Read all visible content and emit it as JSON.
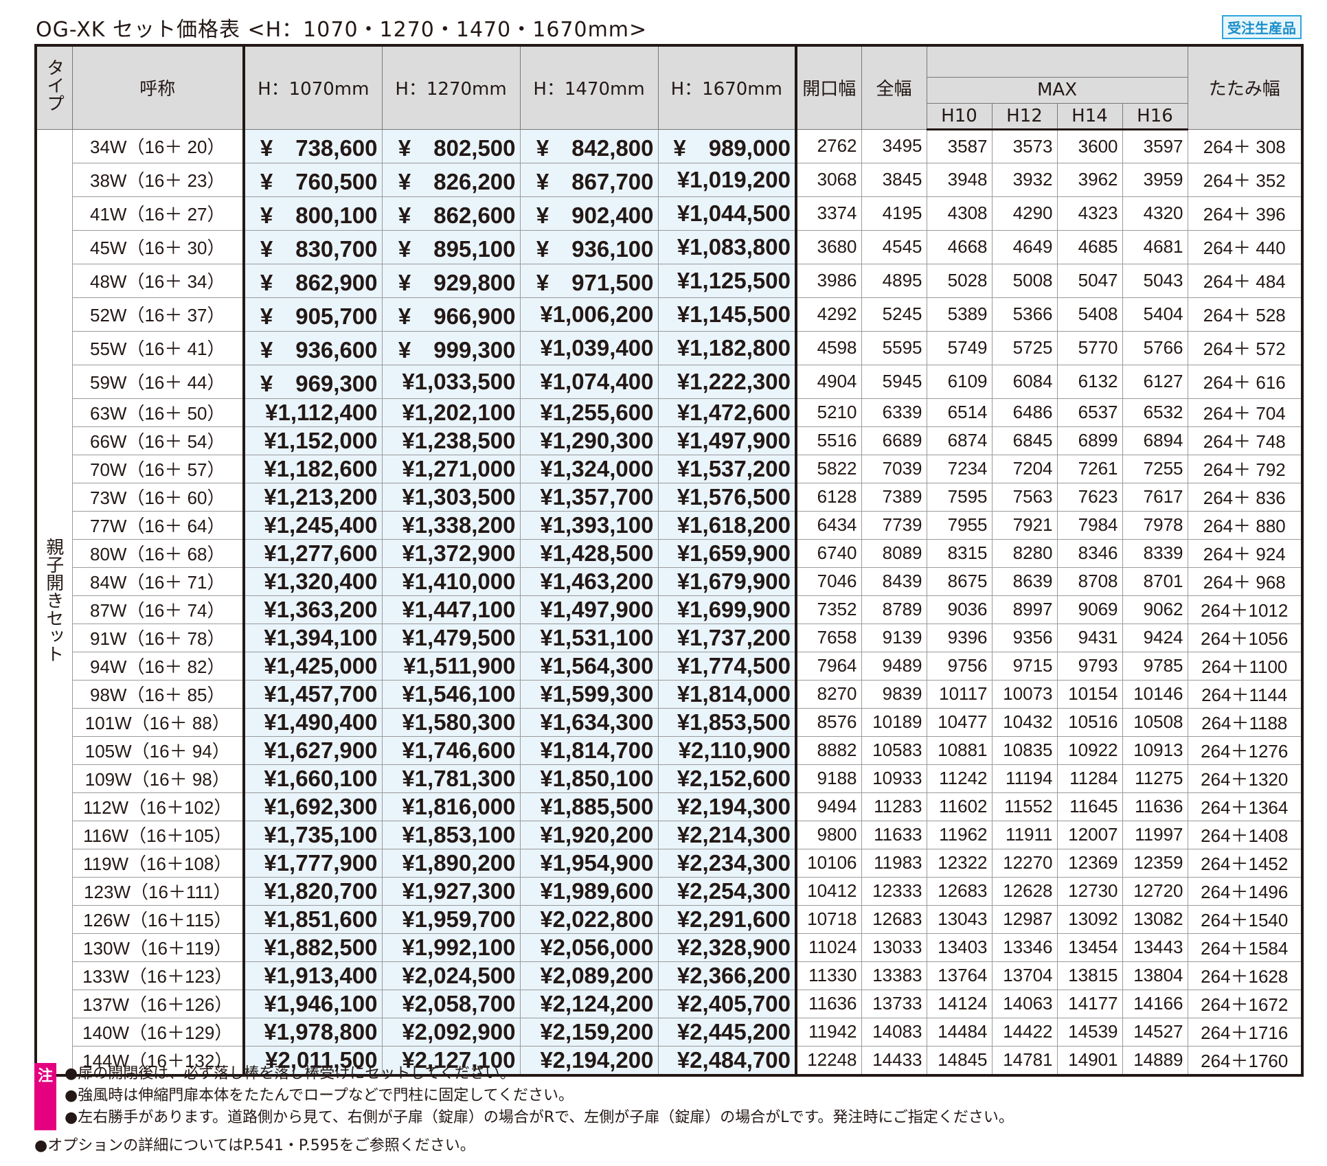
{
  "title": "OG-XK セット価格表 <H：1070・1270・1470・1670mm>",
  "badge": "受注生産品",
  "headers": {
    "type": "タイプ",
    "name": "呼称",
    "h1070": "H：1070mm",
    "h1270": "H：1270mm",
    "h1470": "H：1470mm",
    "h1670": "H：1670mm",
    "opening": "開口幅",
    "total": "全幅",
    "max": "MAX",
    "h10": "H10",
    "h12": "H12",
    "h14": "H14",
    "h16": "H16",
    "fold": "たたみ幅"
  },
  "type_label": "親子開きセット",
  "rows": [
    {
      "name": "34W（16＋ 20）",
      "p1": "¥　738,600",
      "p2": "¥　802,500",
      "p3": "¥　842,800",
      "p4": "¥　989,000",
      "open": "2762",
      "total": "3495",
      "h10": "3587",
      "h12": "3573",
      "h14": "3600",
      "h16": "3597",
      "fold": "264＋ 308"
    },
    {
      "name": "38W（16＋ 23）",
      "p1": "¥　760,500",
      "p2": "¥　826,200",
      "p3": "¥　867,700",
      "p4": "¥1,019,200",
      "open": "3068",
      "total": "3845",
      "h10": "3948",
      "h12": "3932",
      "h14": "3962",
      "h16": "3959",
      "fold": "264＋ 352"
    },
    {
      "name": "41W（16＋ 27）",
      "p1": "¥　800,100",
      "p2": "¥　862,600",
      "p3": "¥　902,400",
      "p4": "¥1,044,500",
      "open": "3374",
      "total": "4195",
      "h10": "4308",
      "h12": "4290",
      "h14": "4323",
      "h16": "4320",
      "fold": "264＋ 396"
    },
    {
      "name": "45W（16＋ 30）",
      "p1": "¥　830,700",
      "p2": "¥　895,100",
      "p3": "¥　936,100",
      "p4": "¥1,083,800",
      "open": "3680",
      "total": "4545",
      "h10": "4668",
      "h12": "4649",
      "h14": "4685",
      "h16": "4681",
      "fold": "264＋ 440"
    },
    {
      "name": "48W（16＋ 34）",
      "p1": "¥　862,900",
      "p2": "¥　929,800",
      "p3": "¥　971,500",
      "p4": "¥1,125,500",
      "open": "3986",
      "total": "4895",
      "h10": "5028",
      "h12": "5008",
      "h14": "5047",
      "h16": "5043",
      "fold": "264＋ 484"
    },
    {
      "name": "52W（16＋ 37）",
      "p1": "¥　905,700",
      "p2": "¥　966,900",
      "p3": "¥1,006,200",
      "p4": "¥1,145,500",
      "open": "4292",
      "total": "5245",
      "h10": "5389",
      "h12": "5366",
      "h14": "5408",
      "h16": "5404",
      "fold": "264＋ 528"
    },
    {
      "name": "55W（16＋ 41）",
      "p1": "¥　936,600",
      "p2": "¥　999,300",
      "p3": "¥1,039,400",
      "p4": "¥1,182,800",
      "open": "4598",
      "total": "5595",
      "h10": "5749",
      "h12": "5725",
      "h14": "5770",
      "h16": "5766",
      "fold": "264＋ 572"
    },
    {
      "name": "59W（16＋ 44）",
      "p1": "¥　969,300",
      "p2": "¥1,033,500",
      "p3": "¥1,074,400",
      "p4": "¥1,222,300",
      "open": "4904",
      "total": "5945",
      "h10": "6109",
      "h12": "6084",
      "h14": "6132",
      "h16": "6127",
      "fold": "264＋ 616"
    },
    {
      "name": "63W（16＋ 50）",
      "p1": "¥1,112,400",
      "p2": "¥1,202,100",
      "p3": "¥1,255,600",
      "p4": "¥1,472,600",
      "open": "5210",
      "total": "6339",
      "h10": "6514",
      "h12": "6486",
      "h14": "6537",
      "h16": "6532",
      "fold": "264＋ 704"
    },
    {
      "name": "66W（16＋ 54）",
      "p1": "¥1,152,000",
      "p2": "¥1,238,500",
      "p3": "¥1,290,300",
      "p4": "¥1,497,900",
      "open": "5516",
      "total": "6689",
      "h10": "6874",
      "h12": "6845",
      "h14": "6899",
      "h16": "6894",
      "fold": "264＋ 748"
    },
    {
      "name": "70W（16＋ 57）",
      "p1": "¥1,182,600",
      "p2": "¥1,271,000",
      "p3": "¥1,324,000",
      "p4": "¥1,537,200",
      "open": "5822",
      "total": "7039",
      "h10": "7234",
      "h12": "7204",
      "h14": "7261",
      "h16": "7255",
      "fold": "264＋ 792"
    },
    {
      "name": "73W（16＋ 60）",
      "p1": "¥1,213,200",
      "p2": "¥1,303,500",
      "p3": "¥1,357,700",
      "p4": "¥1,576,500",
      "open": "6128",
      "total": "7389",
      "h10": "7595",
      "h12": "7563",
      "h14": "7623",
      "h16": "7617",
      "fold": "264＋ 836"
    },
    {
      "name": "77W（16＋ 64）",
      "p1": "¥1,245,400",
      "p2": "¥1,338,200",
      "p3": "¥1,393,100",
      "p4": "¥1,618,200",
      "open": "6434",
      "total": "7739",
      "h10": "7955",
      "h12": "7921",
      "h14": "7984",
      "h16": "7978",
      "fold": "264＋ 880"
    },
    {
      "name": "80W（16＋ 68）",
      "p1": "¥1,277,600",
      "p2": "¥1,372,900",
      "p3": "¥1,428,500",
      "p4": "¥1,659,900",
      "open": "6740",
      "total": "8089",
      "h10": "8315",
      "h12": "8280",
      "h14": "8346",
      "h16": "8339",
      "fold": "264＋ 924"
    },
    {
      "name": "84W（16＋ 71）",
      "p1": "¥1,320,400",
      "p2": "¥1,410,000",
      "p3": "¥1,463,200",
      "p4": "¥1,679,900",
      "open": "7046",
      "total": "8439",
      "h10": "8675",
      "h12": "8639",
      "h14": "8708",
      "h16": "8701",
      "fold": "264＋ 968"
    },
    {
      "name": "87W（16＋ 74）",
      "p1": "¥1,363,200",
      "p2": "¥1,447,100",
      "p3": "¥1,497,900",
      "p4": "¥1,699,900",
      "open": "7352",
      "total": "8789",
      "h10": "9036",
      "h12": "8997",
      "h14": "9069",
      "h16": "9062",
      "fold": "264＋1012"
    },
    {
      "name": "91W（16＋ 78）",
      "p1": "¥1,394,100",
      "p2": "¥1,479,500",
      "p3": "¥1,531,100",
      "p4": "¥1,737,200",
      "open": "7658",
      "total": "9139",
      "h10": "9396",
      "h12": "9356",
      "h14": "9431",
      "h16": "9424",
      "fold": "264＋1056"
    },
    {
      "name": "94W（16＋ 82）",
      "p1": "¥1,425,000",
      "p2": "¥1,511,900",
      "p3": "¥1,564,300",
      "p4": "¥1,774,500",
      "open": "7964",
      "total": "9489",
      "h10": "9756",
      "h12": "9715",
      "h14": "9793",
      "h16": "9785",
      "fold": "264＋1100"
    },
    {
      "name": "98W（16＋ 85）",
      "p1": "¥1,457,700",
      "p2": "¥1,546,100",
      "p3": "¥1,599,300",
      "p4": "¥1,814,000",
      "open": "8270",
      "total": "9839",
      "h10": "10117",
      "h12": "10073",
      "h14": "10154",
      "h16": "10146",
      "fold": "264＋1144"
    },
    {
      "name": "101W（16＋ 88）",
      "p1": "¥1,490,400",
      "p2": "¥1,580,300",
      "p3": "¥1,634,300",
      "p4": "¥1,853,500",
      "open": "8576",
      "total": "10189",
      "h10": "10477",
      "h12": "10432",
      "h14": "10516",
      "h16": "10508",
      "fold": "264＋1188"
    },
    {
      "name": "105W（16＋ 94）",
      "p1": "¥1,627,900",
      "p2": "¥1,746,600",
      "p3": "¥1,814,700",
      "p4": "¥2,110,900",
      "open": "8882",
      "total": "10583",
      "h10": "10881",
      "h12": "10835",
      "h14": "10922",
      "h16": "10913",
      "fold": "264＋1276"
    },
    {
      "name": "109W（16＋ 98）",
      "p1": "¥1,660,100",
      "p2": "¥1,781,300",
      "p3": "¥1,850,100",
      "p4": "¥2,152,600",
      "open": "9188",
      "total": "10933",
      "h10": "11242",
      "h12": "11194",
      "h14": "11284",
      "h16": "11275",
      "fold": "264＋1320"
    },
    {
      "name": "112W（16＋102）",
      "p1": "¥1,692,300",
      "p2": "¥1,816,000",
      "p3": "¥1,885,500",
      "p4": "¥2,194,300",
      "open": "9494",
      "total": "11283",
      "h10": "11602",
      "h12": "11552",
      "h14": "11645",
      "h16": "11636",
      "fold": "264＋1364"
    },
    {
      "name": "116W（16＋105）",
      "p1": "¥1,735,100",
      "p2": "¥1,853,100",
      "p3": "¥1,920,200",
      "p4": "¥2,214,300",
      "open": "9800",
      "total": "11633",
      "h10": "11962",
      "h12": "11911",
      "h14": "12007",
      "h16": "11997",
      "fold": "264＋1408"
    },
    {
      "name": "119W（16＋108）",
      "p1": "¥1,777,900",
      "p2": "¥1,890,200",
      "p3": "¥1,954,900",
      "p4": "¥2,234,300",
      "open": "10106",
      "total": "11983",
      "h10": "12322",
      "h12": "12270",
      "h14": "12369",
      "h16": "12359",
      "fold": "264＋1452"
    },
    {
      "name": "123W（16＋111）",
      "p1": "¥1,820,700",
      "p2": "¥1,927,300",
      "p3": "¥1,989,600",
      "p4": "¥2,254,300",
      "open": "10412",
      "total": "12333",
      "h10": "12683",
      "h12": "12628",
      "h14": "12730",
      "h16": "12720",
      "fold": "264＋1496"
    },
    {
      "name": "126W（16＋115）",
      "p1": "¥1,851,600",
      "p2": "¥1,959,700",
      "p3": "¥2,022,800",
      "p4": "¥2,291,600",
      "open": "10718",
      "total": "12683",
      "h10": "13043",
      "h12": "12987",
      "h14": "13092",
      "h16": "13082",
      "fold": "264＋1540"
    },
    {
      "name": "130W（16＋119）",
      "p1": "¥1,882,500",
      "p2": "¥1,992,100",
      "p3": "¥2,056,000",
      "p4": "¥2,328,900",
      "open": "11024",
      "total": "13033",
      "h10": "13403",
      "h12": "13346",
      "h14": "13454",
      "h16": "13443",
      "fold": "264＋1584"
    },
    {
      "name": "133W（16＋123）",
      "p1": "¥1,913,400",
      "p2": "¥2,024,500",
      "p3": "¥2,089,200",
      "p4": "¥2,366,200",
      "open": "11330",
      "total": "13383",
      "h10": "13764",
      "h12": "13704",
      "h14": "13815",
      "h16": "13804",
      "fold": "264＋1628"
    },
    {
      "name": "137W（16＋126）",
      "p1": "¥1,946,100",
      "p2": "¥2,058,700",
      "p3": "¥2,124,200",
      "p4": "¥2,405,700",
      "open": "11636",
      "total": "13733",
      "h10": "14124",
      "h12": "14063",
      "h14": "14177",
      "h16": "14166",
      "fold": "264＋1672"
    },
    {
      "name": "140W（16＋129）",
      "p1": "¥1,978,800",
      "p2": "¥2,092,900",
      "p3": "¥2,159,200",
      "p4": "¥2,445,200",
      "open": "11942",
      "total": "14083",
      "h10": "14484",
      "h12": "14422",
      "h14": "14539",
      "h16": "14527",
      "fold": "264＋1716"
    },
    {
      "name": "144W（16＋132）",
      "p1": "¥2,011,500",
      "p2": "¥2,127,100",
      "p3": "¥2,194,200",
      "p4": "¥2,484,700",
      "open": "12248",
      "total": "14433",
      "h10": "14845",
      "h12": "14781",
      "h14": "14901",
      "h16": "14889",
      "fold": "264＋1760"
    }
  ],
  "note_mark": "注",
  "notes": [
    "●扉の開閉後は、必ず落し棒を落し棒受けにセットしてください。",
    "●強風時は伸縮門扉本体をたたんでロープなどで門柱に固定してください。",
    "●左右勝手があります。道路側から見て、右側が子扉（錠扉）の場合がRで、左側が子扉（錠扉）の場合がLです。発注時にご指定ください。"
  ],
  "option_note": "●オプションの詳細についてはP.541・P.595をご参照ください。"
}
